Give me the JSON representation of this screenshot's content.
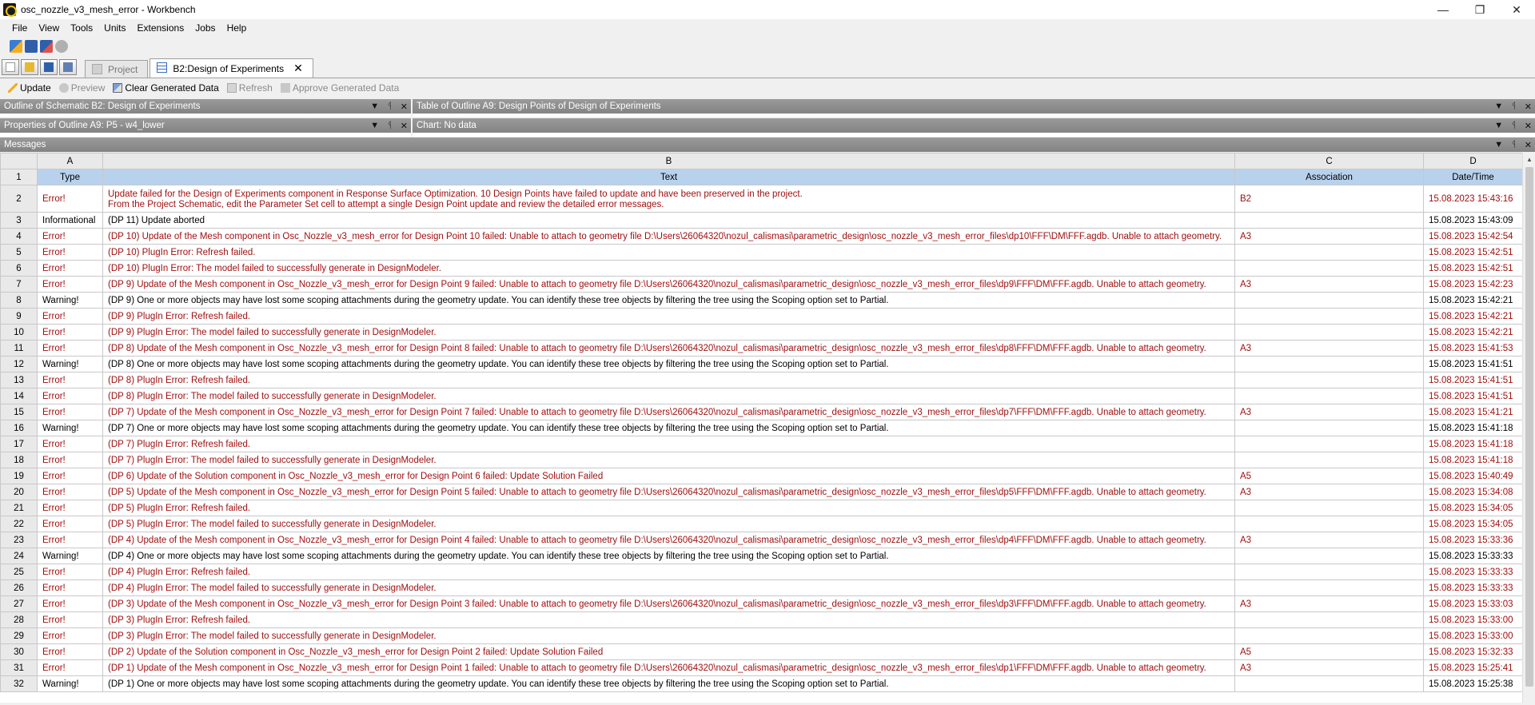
{
  "window": {
    "title": "osc_nozzle_v3_mesh_error - Workbench",
    "controls": [
      "—",
      "❐",
      "✕"
    ]
  },
  "menu": [
    "File",
    "View",
    "Tools",
    "Units",
    "Extensions",
    "Jobs",
    "Help"
  ],
  "tabs": [
    {
      "label": "Project",
      "active": false
    },
    {
      "label": "B2:Design of Experiments",
      "active": true,
      "close": "✕"
    }
  ],
  "toolbar2": {
    "update": "Update",
    "preview": "Preview",
    "clear": "Clear Generated Data",
    "refresh": "Refresh",
    "approve": "Approve Generated Data"
  },
  "panes": {
    "outline": "Outline of Schematic B2: Design of Experiments",
    "table": "Table of Outline A9: Design Points of Design of Experiments",
    "properties": "Properties of Outline A9: P5 - w4_lower",
    "chart": "Chart: No data",
    "messages": "Messages",
    "ctrl_dropdown": "▼",
    "ctrl_pin": "ᛩ",
    "ctrl_close": "✕"
  },
  "grid": {
    "col_letters": [
      "A",
      "B",
      "C",
      "D"
    ],
    "headers": [
      "Type",
      "Text",
      "Association",
      "Date/Time"
    ],
    "rows": [
      {
        "n": "2",
        "type": "Error!",
        "text": "Update failed for the Design of Experiments component in Response Surface Optimization. 10 Design Points have failed to update and have been preserved in the project.",
        "text2": "From the Project Schematic, edit the Parameter Set cell to attempt a single Design Point update and review the detailed error messages.",
        "assoc": "B2",
        "dt": "15.08.2023 15:43:16",
        "kind": "err"
      },
      {
        "n": "3",
        "type": "Informational",
        "text": "(DP 11) Update aborted",
        "assoc": "",
        "dt": "15.08.2023 15:43:09",
        "kind": "info"
      },
      {
        "n": "4",
        "type": "Error!",
        "text": "(DP 10) Update of the Mesh component in Osc_Nozzle_v3_mesh_error for Design Point 10 failed: Unable to attach to geometry file D:\\Users\\26064320\\nozul_calismasi\\parametric_design\\osc_nozzle_v3_mesh_error_files\\dp10\\FFF\\DM\\FFF.agdb. Unable to attach geometry.",
        "assoc": "A3",
        "dt": "15.08.2023 15:42:54",
        "kind": "err"
      },
      {
        "n": "5",
        "type": "Error!",
        "text": "(DP 10) PlugIn Error: Refresh failed.",
        "assoc": "",
        "dt": "15.08.2023 15:42:51",
        "kind": "err"
      },
      {
        "n": "6",
        "type": "Error!",
        "text": "(DP 10) PlugIn Error: The model failed to successfully generate in DesignModeler.",
        "assoc": "",
        "dt": "15.08.2023 15:42:51",
        "kind": "err"
      },
      {
        "n": "7",
        "type": "Error!",
        "text": "(DP 9) Update of the Mesh component in Osc_Nozzle_v3_mesh_error for Design Point 9 failed: Unable to attach to geometry file D:\\Users\\26064320\\nozul_calismasi\\parametric_design\\osc_nozzle_v3_mesh_error_files\\dp9\\FFF\\DM\\FFF.agdb. Unable to attach geometry.",
        "assoc": "A3",
        "dt": "15.08.2023 15:42:23",
        "kind": "err"
      },
      {
        "n": "8",
        "type": "Warning!",
        "text": "(DP 9) One or more objects may have lost some scoping attachments during the geometry update. You can identify these tree objects by filtering the tree using the Scoping option set to Partial.",
        "assoc": "",
        "dt": "15.08.2023 15:42:21",
        "kind": "warn"
      },
      {
        "n": "9",
        "type": "Error!",
        "text": "(DP 9) PlugIn Error: Refresh failed.",
        "assoc": "",
        "dt": "15.08.2023 15:42:21",
        "kind": "err"
      },
      {
        "n": "10",
        "type": "Error!",
        "text": "(DP 9) PlugIn Error: The model failed to successfully generate in DesignModeler.",
        "assoc": "",
        "dt": "15.08.2023 15:42:21",
        "kind": "err"
      },
      {
        "n": "11",
        "type": "Error!",
        "text": "(DP 8) Update of the Mesh component in Osc_Nozzle_v3_mesh_error for Design Point 8 failed: Unable to attach to geometry file D:\\Users\\26064320\\nozul_calismasi\\parametric_design\\osc_nozzle_v3_mesh_error_files\\dp8\\FFF\\DM\\FFF.agdb. Unable to attach geometry.",
        "assoc": "A3",
        "dt": "15.08.2023 15:41:53",
        "kind": "err"
      },
      {
        "n": "12",
        "type": "Warning!",
        "text": "(DP 8) One or more objects may have lost some scoping attachments during the geometry update. You can identify these tree objects by filtering the tree using the Scoping option set to Partial.",
        "assoc": "",
        "dt": "15.08.2023 15:41:51",
        "kind": "warn"
      },
      {
        "n": "13",
        "type": "Error!",
        "text": "(DP 8) PlugIn Error: Refresh failed.",
        "assoc": "",
        "dt": "15.08.2023 15:41:51",
        "kind": "err"
      },
      {
        "n": "14",
        "type": "Error!",
        "text": "(DP 8) PlugIn Error: The model failed to successfully generate in DesignModeler.",
        "assoc": "",
        "dt": "15.08.2023 15:41:51",
        "kind": "err"
      },
      {
        "n": "15",
        "type": "Error!",
        "text": "(DP 7) Update of the Mesh component in Osc_Nozzle_v3_mesh_error for Design Point 7 failed: Unable to attach to geometry file D:\\Users\\26064320\\nozul_calismasi\\parametric_design\\osc_nozzle_v3_mesh_error_files\\dp7\\FFF\\DM\\FFF.agdb. Unable to attach geometry.",
        "assoc": "A3",
        "dt": "15.08.2023 15:41:21",
        "kind": "err"
      },
      {
        "n": "16",
        "type": "Warning!",
        "text": "(DP 7) One or more objects may have lost some scoping attachments during the geometry update. You can identify these tree objects by filtering the tree using the Scoping option set to Partial.",
        "assoc": "",
        "dt": "15.08.2023 15:41:18",
        "kind": "warn"
      },
      {
        "n": "17",
        "type": "Error!",
        "text": "(DP 7) PlugIn Error: Refresh failed.",
        "assoc": "",
        "dt": "15.08.2023 15:41:18",
        "kind": "err"
      },
      {
        "n": "18",
        "type": "Error!",
        "text": "(DP 7) PlugIn Error: The model failed to successfully generate in DesignModeler.",
        "assoc": "",
        "dt": "15.08.2023 15:41:18",
        "kind": "err"
      },
      {
        "n": "19",
        "type": "Error!",
        "text": "(DP 6) Update of the Solution component in Osc_Nozzle_v3_mesh_error for Design Point 6 failed: Update Solution Failed",
        "assoc": "A5",
        "dt": "15.08.2023 15:40:49",
        "kind": "err"
      },
      {
        "n": "20",
        "type": "Error!",
        "text": "(DP 5) Update of the Mesh component in Osc_Nozzle_v3_mesh_error for Design Point 5 failed: Unable to attach to geometry file D:\\Users\\26064320\\nozul_calismasi\\parametric_design\\osc_nozzle_v3_mesh_error_files\\dp5\\FFF\\DM\\FFF.agdb. Unable to attach geometry.",
        "assoc": "A3",
        "dt": "15.08.2023 15:34:08",
        "kind": "err"
      },
      {
        "n": "21",
        "type": "Error!",
        "text": "(DP 5) PlugIn Error: Refresh failed.",
        "assoc": "",
        "dt": "15.08.2023 15:34:05",
        "kind": "err"
      },
      {
        "n": "22",
        "type": "Error!",
        "text": "(DP 5) PlugIn Error: The model failed to successfully generate in DesignModeler.",
        "assoc": "",
        "dt": "15.08.2023 15:34:05",
        "kind": "err"
      },
      {
        "n": "23",
        "type": "Error!",
        "text": "(DP 4) Update of the Mesh component in Osc_Nozzle_v3_mesh_error for Design Point 4 failed: Unable to attach to geometry file D:\\Users\\26064320\\nozul_calismasi\\parametric_design\\osc_nozzle_v3_mesh_error_files\\dp4\\FFF\\DM\\FFF.agdb. Unable to attach geometry.",
        "assoc": "A3",
        "dt": "15.08.2023 15:33:36",
        "kind": "err"
      },
      {
        "n": "24",
        "type": "Warning!",
        "text": "(DP 4) One or more objects may have lost some scoping attachments during the geometry update. You can identify these tree objects by filtering the tree using the Scoping option set to Partial.",
        "assoc": "",
        "dt": "15.08.2023 15:33:33",
        "kind": "warn"
      },
      {
        "n": "25",
        "type": "Error!",
        "text": "(DP 4) PlugIn Error: Refresh failed.",
        "assoc": "",
        "dt": "15.08.2023 15:33:33",
        "kind": "err"
      },
      {
        "n": "26",
        "type": "Error!",
        "text": "(DP 4) PlugIn Error: The model failed to successfully generate in DesignModeler.",
        "assoc": "",
        "dt": "15.08.2023 15:33:33",
        "kind": "err"
      },
      {
        "n": "27",
        "type": "Error!",
        "text": "(DP 3) Update of the Mesh component in Osc_Nozzle_v3_mesh_error for Design Point 3 failed: Unable to attach to geometry file D:\\Users\\26064320\\nozul_calismasi\\parametric_design\\osc_nozzle_v3_mesh_error_files\\dp3\\FFF\\DM\\FFF.agdb. Unable to attach geometry.",
        "assoc": "A3",
        "dt": "15.08.2023 15:33:03",
        "kind": "err"
      },
      {
        "n": "28",
        "type": "Error!",
        "text": "(DP 3) PlugIn Error: Refresh failed.",
        "assoc": "",
        "dt": "15.08.2023 15:33:00",
        "kind": "err"
      },
      {
        "n": "29",
        "type": "Error!",
        "text": "(DP 3) PlugIn Error: The model failed to successfully generate in DesignModeler.",
        "assoc": "",
        "dt": "15.08.2023 15:33:00",
        "kind": "err"
      },
      {
        "n": "30",
        "type": "Error!",
        "text": "(DP 2) Update of the Solution component in Osc_Nozzle_v3_mesh_error for Design Point 2 failed: Update Solution Failed",
        "assoc": "A5",
        "dt": "15.08.2023 15:32:33",
        "kind": "err"
      },
      {
        "n": "31",
        "type": "Error!",
        "text": "(DP 1) Update of the Mesh component in Osc_Nozzle_v3_mesh_error for Design Point 1 failed: Unable to attach to geometry file D:\\Users\\26064320\\nozul_calismasi\\parametric_design\\osc_nozzle_v3_mesh_error_files\\dp1\\FFF\\DM\\FFF.agdb. Unable to attach geometry.",
        "assoc": "A3",
        "dt": "15.08.2023 15:25:41",
        "kind": "err"
      },
      {
        "n": "32",
        "type": "Warning!",
        "text": "(DP 1) One or more objects may have lost some scoping attachments during the geometry update. You can identify these tree objects by filtering the tree using the Scoping option set to Partial.",
        "assoc": "",
        "dt": "15.08.2023 15:25:38",
        "kind": "warn"
      }
    ]
  }
}
